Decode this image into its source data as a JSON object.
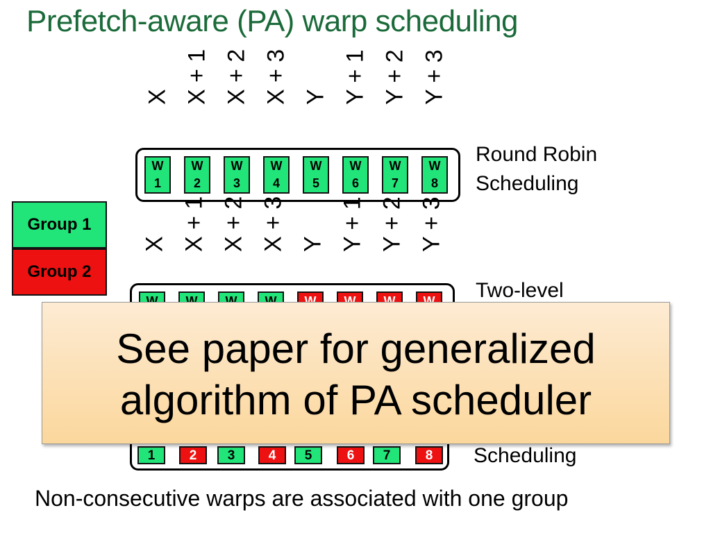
{
  "title": "Prefetch-aware (PA) warp scheduling",
  "labels": [
    "X",
    "X + 1",
    "X + 2",
    "X + 3",
    "Y",
    "Y + 1",
    "Y + 2",
    "Y + 3"
  ],
  "round_robin": {
    "label_line1": "Round Robin",
    "label_line2": "Scheduling",
    "warps": [
      {
        "w": "W",
        "n": "1",
        "group": 1
      },
      {
        "w": "W",
        "n": "2",
        "group": 1
      },
      {
        "w": "W",
        "n": "3",
        "group": 1
      },
      {
        "w": "W",
        "n": "4",
        "group": 1
      },
      {
        "w": "W",
        "n": "5",
        "group": 1
      },
      {
        "w": "W",
        "n": "6",
        "group": 1
      },
      {
        "w": "W",
        "n": "7",
        "group": 1
      },
      {
        "w": "W",
        "n": "8",
        "group": 1
      }
    ]
  },
  "two_level": {
    "label_line1": "Two-level",
    "warps": [
      {
        "w": "W",
        "group": 1
      },
      {
        "w": "W",
        "group": 1
      },
      {
        "w": "W",
        "group": 1
      },
      {
        "w": "W",
        "group": 1
      },
      {
        "w": "W",
        "group": 2
      },
      {
        "w": "W",
        "group": 2
      },
      {
        "w": "W",
        "group": 2
      },
      {
        "w": "W",
        "group": 2
      }
    ]
  },
  "prefetch_aware": {
    "label_line2": "Scheduling",
    "warps": [
      {
        "n": "1",
        "group": 1
      },
      {
        "n": "2",
        "group": 2
      },
      {
        "n": "3",
        "group": 1
      },
      {
        "n": "4",
        "group": 2
      },
      {
        "n": "5",
        "group": 1
      },
      {
        "n": "6",
        "group": 2
      },
      {
        "n": "7",
        "group": 1
      },
      {
        "n": "8",
        "group": 2
      }
    ]
  },
  "legend": {
    "group1": "Group 1",
    "group2": "Group 2"
  },
  "colors": {
    "group1": "#22e57a",
    "group2": "#ee1111",
    "title": "#1b6b3a",
    "overlay": "#fbd79c"
  },
  "overlay": {
    "line1": "See paper for generalized",
    "line2": "algorithm of PA scheduler"
  },
  "footer": "Non-consecutive warps are associated with one group"
}
